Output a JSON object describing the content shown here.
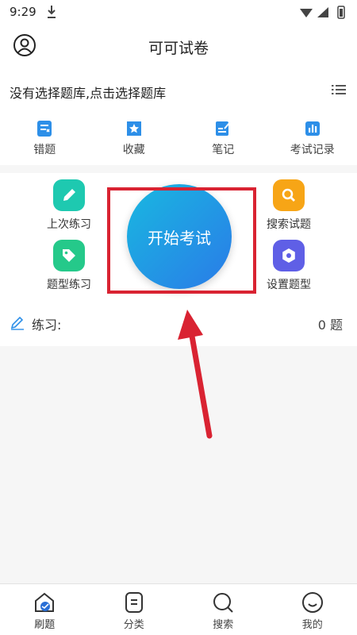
{
  "status_bar": {
    "time": "9:29"
  },
  "header": {
    "title": "可可试卷"
  },
  "bank": {
    "prompt": "没有选择题库,点击选择题库"
  },
  "quick": [
    {
      "label": "错题",
      "icon": "wrong-questions-icon"
    },
    {
      "label": "收藏",
      "icon": "favorites-icon"
    },
    {
      "label": "笔记",
      "icon": "notes-icon"
    },
    {
      "label": "考试记录",
      "icon": "exam-records-icon"
    }
  ],
  "features": {
    "last_practice": "上次练习",
    "type_practice": "题型练习",
    "search_questions": "搜索试题",
    "set_types": "设置题型"
  },
  "start_button": "开始考试",
  "practice": {
    "label": "练习:",
    "count": "0 题"
  },
  "bottom_nav": [
    {
      "label": "刷题",
      "icon": "home-icon"
    },
    {
      "label": "分类",
      "icon": "category-icon"
    },
    {
      "label": "搜索",
      "icon": "search-icon"
    },
    {
      "label": "我的",
      "icon": "profile-icon"
    }
  ],
  "colors": {
    "accent": "#2a8be8",
    "teal": "#1ec9b0",
    "green": "#25c98a",
    "orange": "#f7a516",
    "purple": "#5f5fe6",
    "annotation_red": "#d92332"
  }
}
